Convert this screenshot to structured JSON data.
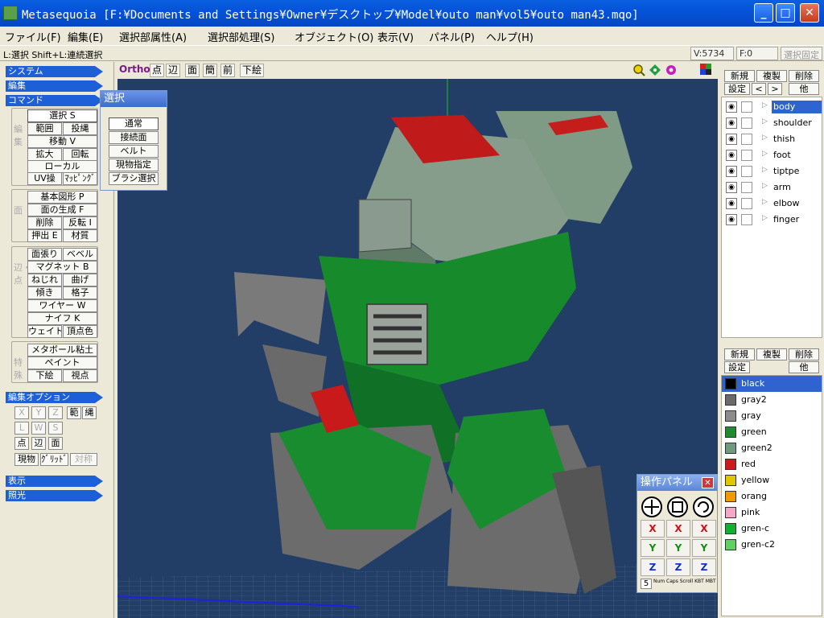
{
  "window": {
    "title": "Metasequoia [F:¥Documents and Settings¥Owner¥デスクトップ¥Model¥outo man¥vol5¥outo man43.mqo]",
    "minimize": "_",
    "maximize": "□",
    "close": "✕"
  },
  "menu": [
    "ファイル(F)",
    "編集(E)",
    "選択部属性(A)",
    "選択部処理(S)",
    "オブジェクト(O)",
    "表示(V)",
    "パネル(P)",
    "ヘルプ(H)"
  ],
  "status": {
    "hint": "L:選択  Shift+L:連続選択",
    "vertices": "V:5734",
    "faces": "F:0",
    "selection_fixed": "選択固定"
  },
  "sections": {
    "system": "システム",
    "edit": "編集",
    "command": "コマンド",
    "edit_options": "編集オプション",
    "display": "表示",
    "lighting": "照光"
  },
  "groups": {
    "edit_label": "編集",
    "face_label": "面",
    "edge_vertex_label": "辺・点",
    "special_label": "特殊"
  },
  "commands": {
    "select": "選択 S",
    "range": "範囲",
    "lasso": "投縄",
    "move": "移動 V",
    "scale": "拡大",
    "rotate": "回転",
    "local": "ローカル",
    "uv": "UV操",
    "mapping": "ﾏｯﾋﾟﾝｸﾞ",
    "primitive": "基本図形 P",
    "face_gen": "面の生成 F",
    "delete": "削除",
    "flip": "反転 I",
    "extrude": "押出 E",
    "material": "材質",
    "face_stretch": "面張り",
    "bevel": "ベベル",
    "magnet": "マグネット B",
    "twist": "ねじれ",
    "bend": "曲げ",
    "tilt": "傾き",
    "lattice": "格子",
    "wire": "ワイヤー W",
    "knife": "ナイフ K",
    "weight": "ウェイト",
    "vertex_color": "頂点色",
    "metaball": "メタボール粘土",
    "paint": "ペイント",
    "underlay": "下絵",
    "viewpoint": "視点"
  },
  "edit_options": {
    "x": "X",
    "y": "Y",
    "z": "Z",
    "range": "範",
    "lasso": "縄",
    "l": "L",
    "w": "W",
    "s": "S",
    "point": "点",
    "edge": "辺",
    "face": "面",
    "current": "現物",
    "grid": "ｸﾞﾘｯﾄﾞ",
    "symmetry": "対称"
  },
  "view_toolbar": {
    "ortho": "Ortho",
    "point": "点",
    "edge": "辺",
    "face": "面",
    "simple": "簡",
    "front": "前",
    "underlay": "下絵"
  },
  "select_popup": {
    "title": "選択",
    "items": [
      "通常",
      "接続面",
      "ベルト",
      "現物指定",
      "ブラシ選択"
    ]
  },
  "object_panel": {
    "new": "新規",
    "duplicate": "複製",
    "delete": "削除",
    "settings": "設定",
    "up": "<",
    "down": ">",
    "other": "他",
    "objects": [
      "body",
      "shoulder",
      "thish",
      "foot",
      "tiptpe",
      "arm",
      "elbow",
      "finger"
    ]
  },
  "material_panel": {
    "new": "新規",
    "duplicate": "複製",
    "delete": "削除",
    "settings": "設定",
    "other": "他",
    "materials": [
      {
        "name": "black",
        "color": "#000000"
      },
      {
        "name": "gray2",
        "color": "#6a6a6a"
      },
      {
        "name": "gray",
        "color": "#8c8c8c"
      },
      {
        "name": "green",
        "color": "#1f8a2e"
      },
      {
        "name": "green2",
        "color": "#6f9a80"
      },
      {
        "name": "red",
        "color": "#d01818"
      },
      {
        "name": "yellow",
        "color": "#e0c800"
      },
      {
        "name": "orang",
        "color": "#f09a00"
      },
      {
        "name": "pink",
        "color": "#f4a8c8"
      },
      {
        "name": "gren-c",
        "color": "#10b030"
      },
      {
        "name": "gren-c2",
        "color": "#60d060"
      }
    ]
  },
  "op_panel": {
    "title": "操作パネル",
    "x": "X",
    "y": "Y",
    "z": "Z",
    "grid_value": "5",
    "keys": "Num Caps Scroll KBT MBT"
  }
}
